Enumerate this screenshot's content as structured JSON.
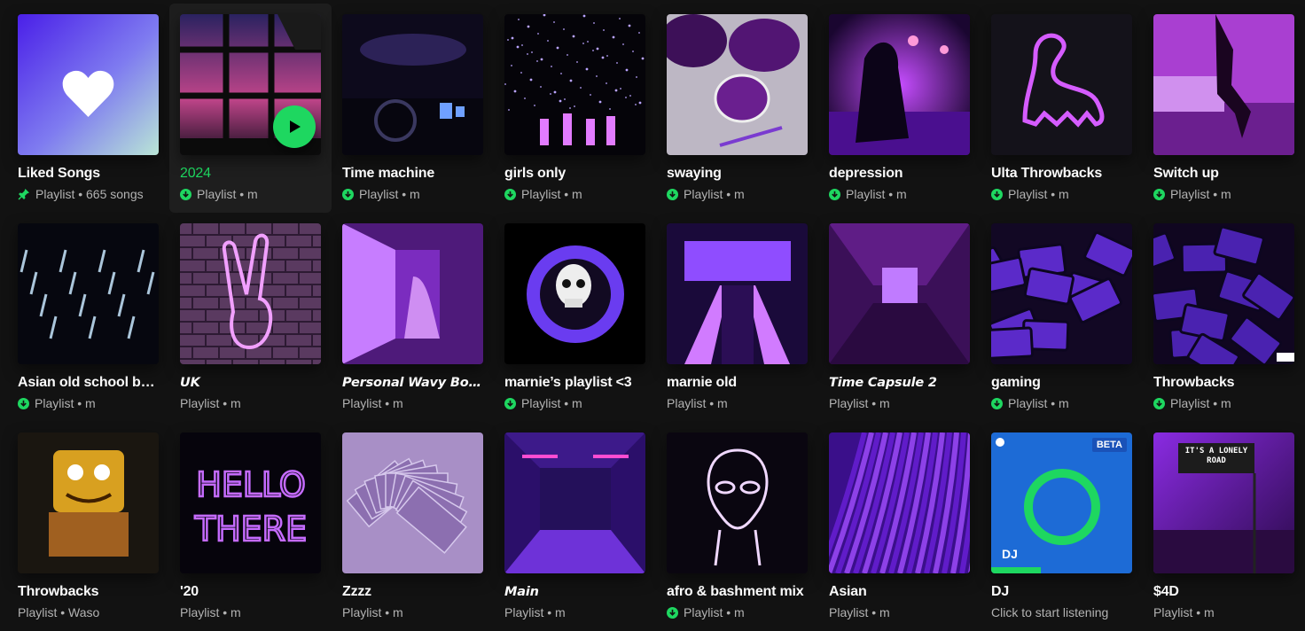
{
  "accent_color": "#1ed760",
  "rows": [
    [
      {
        "title": "Liked Songs",
        "subtitle": "Playlist • 665 songs",
        "indicator": "pin-icon",
        "art": "liked"
      },
      {
        "title": "2024",
        "subtitle": "Playlist • m",
        "indicator": "download-icon",
        "art": "window",
        "hovered": true
      },
      {
        "title": "Time machine",
        "subtitle": "Playlist • m",
        "indicator": "download-icon",
        "art": "car"
      },
      {
        "title": "girls only",
        "subtitle": "Playlist • m",
        "indicator": "download-icon",
        "art": "stars"
      },
      {
        "title": "swaying",
        "subtitle": "Playlist • m",
        "indicator": "download-icon",
        "art": "glasses"
      },
      {
        "title": "depression",
        "subtitle": "Playlist • m",
        "indicator": "download-icon",
        "art": "girl"
      },
      {
        "title": "Ulta Throwbacks",
        "subtitle": "Playlist • m",
        "indicator": "download-icon",
        "art": "dino"
      },
      {
        "title": "Switch up",
        "subtitle": "Playlist • m",
        "indicator": "download-icon",
        "art": "pink-room"
      }
    ],
    [
      {
        "title": "Asian old school ban...",
        "subtitle": "Playlist • m",
        "indicator": "download-icon",
        "art": "lights"
      },
      {
        "title": "UK",
        "subtitle": "Playlist • m",
        "indicator": "none",
        "art": "peace",
        "stylized": true
      },
      {
        "title": "Personal Wavy Bops",
        "subtitle": "Playlist • m",
        "indicator": "none",
        "art": "hallway",
        "stylized": true
      },
      {
        "title": "marnie’s playlist <3",
        "subtitle": "Playlist • m",
        "indicator": "download-icon",
        "art": "skull"
      },
      {
        "title": "marnie old",
        "subtitle": "Playlist • m",
        "indicator": "none",
        "art": "escalator"
      },
      {
        "title": "Time Capsule 2",
        "subtitle": "Playlist • m",
        "indicator": "none",
        "art": "train",
        "stylized": true
      },
      {
        "title": "gaming",
        "subtitle": "Playlist • m",
        "indicator": "download-icon",
        "art": "tapes"
      },
      {
        "title": "Throwbacks",
        "subtitle": "Playlist • m",
        "indicator": "download-icon",
        "art": "tapes2"
      }
    ],
    [
      {
        "title": "Throwbacks",
        "subtitle": "Playlist • Waso",
        "indicator": "none",
        "art": "sponge"
      },
      {
        "title": "'20",
        "subtitle": "Playlist • m",
        "indicator": "none",
        "art": "hello"
      },
      {
        "title": "Zzzz",
        "subtitle": "Playlist • m",
        "indicator": "none",
        "art": "money"
      },
      {
        "title": "Main",
        "subtitle": "Playlist • m",
        "indicator": "none",
        "art": "room",
        "stylized": true
      },
      {
        "title": "afro & bashment mix",
        "subtitle": "Playlist • m",
        "indicator": "download-icon",
        "art": "alien"
      },
      {
        "title": "Asian",
        "subtitle": "Playlist • m",
        "indicator": "none",
        "art": "fur"
      },
      {
        "title": "DJ",
        "subtitle": "Click to start listening",
        "indicator": "none",
        "art": "dj",
        "art_text": {
          "badge": "BETA",
          "label": "DJ"
        }
      },
      {
        "title": "$4D",
        "subtitle": "Playlist • m",
        "indicator": "none",
        "art": "road",
        "art_text": {
          "sign": "IT'S A LONELY ROAD"
        }
      }
    ]
  ],
  "hello_art_text": {
    "line1": "HELLO",
    "line2": "THERE"
  }
}
